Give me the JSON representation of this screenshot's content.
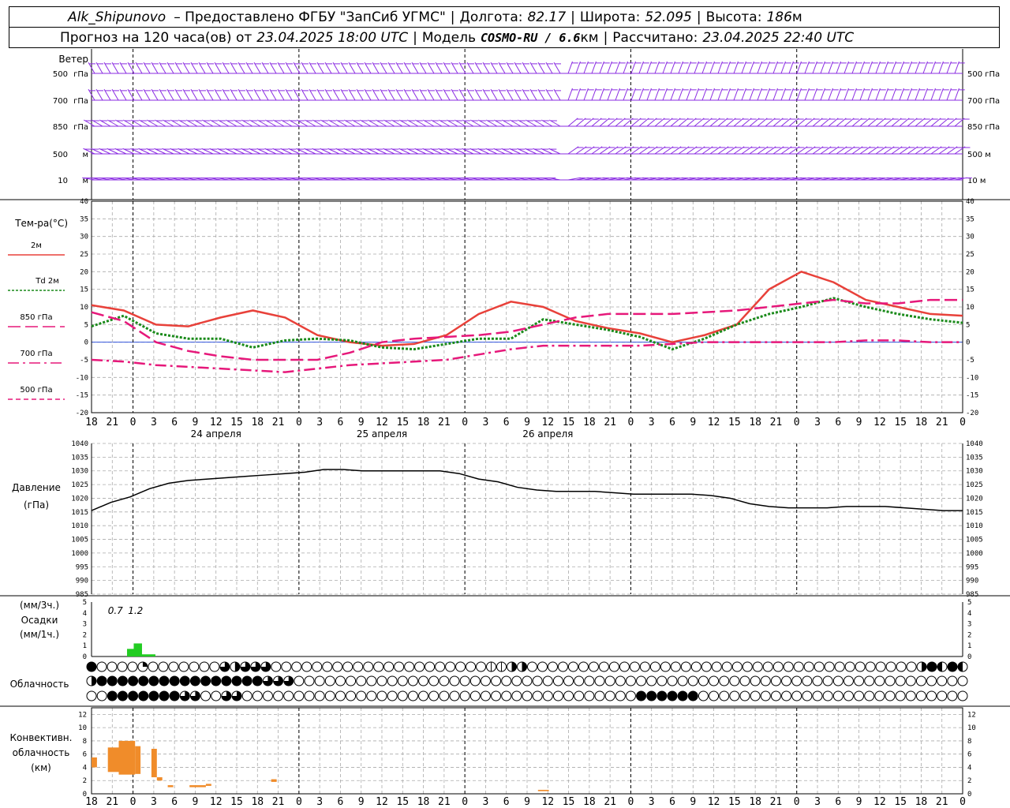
{
  "header": {
    "station": "Alk_Shipunovo",
    "provider": "– Предоставлено ФГБУ \"ЗапСиб УГМС\"",
    "lon_label": "Долгота:",
    "lon_value": "82.17",
    "lat_label": "Широта:",
    "lat_value": "52.095",
    "alt_label": "Высота:",
    "alt_value": "186",
    "alt_unit": "м",
    "forecast_label": "Прогноз на 120 часа(ов) от",
    "forecast_start": "23.04.2025 18:00 UTC",
    "model_label": "Модель",
    "model_name": "COSMO-RU / 6.6",
    "model_unit": "км",
    "calc_label": "Рассчитано:",
    "calc_time": "23.04.2025 22:40 UTC"
  },
  "chart_data": {
    "type": "line",
    "x_hours_utc": [
      18,
      21,
      0,
      3,
      6,
      9,
      12,
      15,
      18,
      21,
      0,
      3,
      6,
      9,
      12,
      15,
      18,
      21,
      0,
      3,
      6,
      9,
      12,
      15,
      18,
      21,
      0,
      3,
      6,
      9,
      12,
      15,
      18,
      21,
      0,
      3,
      6,
      9,
      12,
      15,
      18,
      21,
      0
    ],
    "x_tick_labels": [
      "18",
      "21",
      "0",
      "3",
      "6",
      "9",
      "12",
      "15",
      "18",
      "21",
      "0",
      "3",
      "6",
      "9",
      "12",
      "15",
      "18",
      "21",
      "0",
      "3",
      "6",
      "9",
      "12",
      "15",
      "18",
      "21",
      "0",
      "3",
      "6",
      "9",
      "12",
      "15",
      "18",
      "21",
      "0",
      "3",
      "6",
      "9",
      "12",
      "15",
      "18",
      "21",
      "0"
    ],
    "date_labels": [
      {
        "text": "24 апреля",
        "at_index": 6
      },
      {
        "text": "25 апреля",
        "at_index": 14
      },
      {
        "text": "26 апреля",
        "at_index": 22
      }
    ],
    "wind": {
      "title": "Ветер",
      "levels": [
        "500 гПа",
        "700 гПа",
        "850 гПа",
        "500 м",
        "10 м"
      ],
      "color": "#8a2be2"
    },
    "temperature": {
      "title": "Тем-ра(°С)",
      "ylim": [
        -20,
        40
      ],
      "yticks": [
        -20,
        -15,
        -10,
        -5,
        0,
        5,
        10,
        15,
        20,
        25,
        30,
        35,
        40
      ],
      "series": [
        {
          "name": "2м",
          "color": "#e8413a",
          "style": "solid",
          "values": [
            10.5,
            9,
            5,
            4.5,
            7,
            9,
            7,
            2,
            0,
            -1,
            -0.5,
            2,
            8,
            11.5,
            10,
            6,
            4,
            2.5,
            0,
            2,
            5,
            15,
            20,
            17,
            12,
            10,
            8,
            7.5
          ]
        },
        {
          "name": "Td  2м",
          "color": "#1a8a1a",
          "style": "dotted",
          "values": [
            4.5,
            7.5,
            2.5,
            1,
            1,
            -1.5,
            0.5,
            1,
            0.5,
            -1.5,
            -2,
            -0.5,
            1,
            1,
            6.5,
            5,
            3.5,
            1.5,
            -2,
            1,
            5,
            8,
            10,
            12.5,
            10,
            8,
            6.5,
            5.5
          ]
        },
        {
          "name": "850 гПа",
          "color": "#e6187a",
          "style": "longdash",
          "values": [
            8.5,
            6,
            0,
            -2.5,
            -4,
            -5,
            -5,
            -5,
            -3,
            0,
            1,
            1.5,
            2,
            3,
            5,
            7,
            8,
            8,
            8,
            8.5,
            9,
            10,
            11,
            12,
            11,
            11,
            12,
            12
          ]
        },
        {
          "name": "700 гПа",
          "color": "#e6187a",
          "style": "dashdot",
          "values": [
            -5,
            -5.5,
            -6.5,
            -7,
            -7.5,
            -8,
            -8.5,
            -7.5,
            -6.5,
            -6,
            -5.5,
            -5,
            -3.5,
            -2,
            -1,
            -1,
            -1,
            -1,
            -0.5,
            0,
            0,
            0,
            0,
            0,
            0.5,
            0.5,
            0,
            0
          ]
        },
        {
          "name": "500 гПа",
          "color": "#e6187a",
          "style": "dashed",
          "values": []
        }
      ]
    },
    "pressure": {
      "title": "Давление",
      "unit": "(гПа)",
      "ylim": [
        985,
        1040
      ],
      "yticks": [
        985,
        990,
        995,
        1000,
        1005,
        1010,
        1015,
        1020,
        1025,
        1030,
        1035,
        1040
      ],
      "color": "#000000",
      "values": [
        1015.5,
        1018.5,
        1020.5,
        1023.5,
        1025.5,
        1026.5,
        1027,
        1027.5,
        1028,
        1028.5,
        1029,
        1029.5,
        1030.5,
        1030.5,
        1030,
        1030,
        1030,
        1030,
        1030,
        1029,
        1027,
        1026,
        1024,
        1023,
        1022.5,
        1022.5,
        1022.5,
        1022,
        1021.5,
        1021.5,
        1021.5,
        1021.5,
        1021,
        1020,
        1018,
        1017,
        1016.5,
        1016.5,
        1016.5,
        1017,
        1017,
        1017,
        1016.5,
        1016,
        1015.5,
        1015.5
      ]
    },
    "precipitation": {
      "title": "Осадки",
      "unit_top": "(мм/3ч.)",
      "unit_bottom": "(мм/1ч.)",
      "ylim": [
        0,
        5
      ],
      "yticks": [
        0,
        1,
        2,
        3,
        4,
        5
      ],
      "color": "#22cc22",
      "annotations": [
        {
          "text": "0.7",
          "at_hour": 1.5
        },
        {
          "text": "1.2",
          "at_hour": 4.5
        }
      ],
      "bars": [
        {
          "start_hour": 2,
          "end_hour": 3,
          "value": 0.7
        },
        {
          "start_hour": 3,
          "end_hour": 4,
          "value": 1.2
        },
        {
          "start_hour": 4,
          "end_hour": 6,
          "value": 0.2
        }
      ]
    },
    "cloudiness": {
      "title": "Облачность",
      "rows": [
        "foooocoooooooqhqqqoooooooooooooooooooootthhoooooooooooooooooooooooooooooooooooooohfdfd",
        "hffffffffffffffffqqqooooooooooooooooooooooooooooooooooooooooooooooooooooooooooooooooo",
        "oofffffffqqooqqooooooooooooooooooooooooooooooooooooooffffffoooooooooooooooooooooooooo"
      ]
    },
    "convective": {
      "title_lines": [
        "Конвективн.",
        "облачность",
        "(км)"
      ],
      "ylim": [
        0,
        13
      ],
      "yticks": [
        0,
        2,
        4,
        6,
        8,
        10,
        12
      ],
      "color": "#f08c2a",
      "bars": [
        {
          "start_hour": 0,
          "end_hour": 1,
          "bottom": 4,
          "top": 5.5
        },
        {
          "start_hour": 3,
          "end_hour": 5,
          "bottom": 3.3,
          "top": 7
        },
        {
          "start_hour": 5,
          "end_hour": 8,
          "bottom": 2.9,
          "top": 8
        },
        {
          "start_hour": 8,
          "end_hour": 9,
          "bottom": 3,
          "top": 7.2
        },
        {
          "start_hour": 11,
          "end_hour": 12,
          "bottom": 2.5,
          "top": 6.8
        },
        {
          "start_hour": 12,
          "end_hour": 13,
          "bottom": 2,
          "top": 2.5
        },
        {
          "start_hour": 14,
          "end_hour": 15,
          "bottom": 1,
          "top": 1.3
        },
        {
          "start_hour": 18,
          "end_hour": 21,
          "bottom": 1,
          "top": 1.3
        },
        {
          "start_hour": 21,
          "end_hour": 22,
          "bottom": 1.2,
          "top": 1.5
        },
        {
          "start_hour": 33,
          "end_hour": 34,
          "bottom": 1.8,
          "top": 2.2
        },
        {
          "start_hour": 82,
          "end_hour": 84,
          "bottom": 0.4,
          "top": 0.6
        }
      ]
    }
  }
}
